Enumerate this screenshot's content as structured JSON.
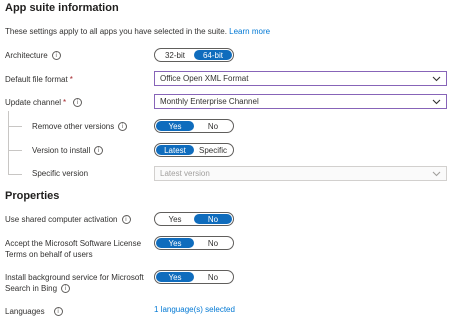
{
  "app_suite": {
    "title": "App suite information",
    "description": "These settings apply to all apps you have selected in the suite.",
    "learn_more": "Learn more",
    "architecture": {
      "label": "Architecture",
      "options": [
        "32-bit",
        "64-bit"
      ],
      "selected": "64-bit"
    },
    "file_format": {
      "label": "Default file format",
      "required_mark": "*",
      "value": "Office Open XML Format"
    },
    "update_channel": {
      "label": "Update channel",
      "required_mark": "*",
      "value": "Monthly Enterprise Channel"
    },
    "remove_other_versions": {
      "label": "Remove other versions",
      "options": [
        "Yes",
        "No"
      ],
      "selected": "Yes"
    },
    "version_to_install": {
      "label": "Version to install",
      "options": [
        "Latest",
        "Specific"
      ],
      "selected": "Latest"
    },
    "specific_version": {
      "label": "Specific version",
      "placeholder": "Latest version"
    }
  },
  "properties": {
    "title": "Properties",
    "shared_computer": {
      "label": "Use shared computer activation",
      "options": [
        "Yes",
        "No"
      ],
      "selected": "No"
    },
    "accept_license": {
      "label_line1": "Accept the Microsoft Software License",
      "label_line2": "Terms on behalf of users",
      "options": [
        "Yes",
        "No"
      ],
      "selected": "Yes"
    },
    "background_service": {
      "label_line1": "Install background service for Microsoft",
      "label_line2": "Search in Bing",
      "options": [
        "Yes",
        "No"
      ],
      "selected": "Yes"
    },
    "languages": {
      "label": "Languages",
      "value": "1 language(s) selected"
    }
  },
  "colors": {
    "accent": "#0f6cbd",
    "link": "#0078d4",
    "focus_border": "#8764b8"
  },
  "icons": {
    "info": "info-icon",
    "dropdown": "chevron-down-icon"
  }
}
